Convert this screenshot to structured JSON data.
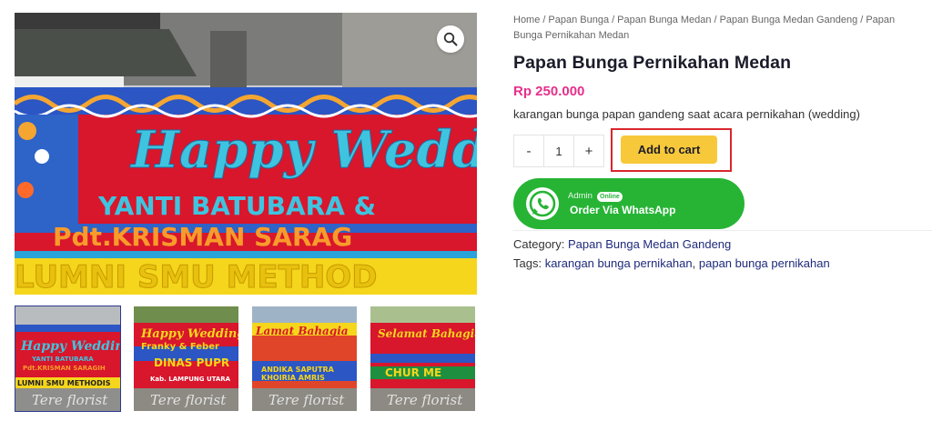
{
  "gallery": {
    "main_image_alt": "Happy Wedding flower board",
    "main_image_text": {
      "line1": "Happy Wedding",
      "line2": "YANTI BATUBARA &",
      "line3": "Pdt.KRISMAN SARAG",
      "line4": "LUMNI SMU METHOD"
    },
    "thumbnails": [
      {
        "l1": "Happy Wedding",
        "l2": "YANTI BATUBARA",
        "l3": "Pdt.KRISMAN SARAGIH",
        "l4": "LUMNI SMU METHODIS",
        "watermark": "Tere florist"
      },
      {
        "l1": "Happy Wedding",
        "l2": "Franky & Feber",
        "l3": "DINAS PUPR",
        "l4": "Kab. LAMPUNG UTARA",
        "watermark": "Tere florist"
      },
      {
        "l1": "Lamat Bahagia",
        "l2": "",
        "l3": "ANDIKA SAPUTRA",
        "l4": "KHOIRIA AMRIS",
        "watermark": "Tere florist"
      },
      {
        "l1": "Selamat Bahagia",
        "l2": "",
        "l3": "",
        "l4": "CHUR ME",
        "watermark": "Tere florist"
      }
    ],
    "zoom_icon": "magnifier-icon"
  },
  "breadcrumb": {
    "items": [
      "Home",
      "Papan Bunga",
      "Papan Bunga Medan",
      "Papan Bunga Medan Gandeng",
      "Papan Bunga Pernikahan Medan"
    ],
    "separator": "/"
  },
  "product": {
    "title": "Papan Bunga Pernikahan Medan",
    "price": "Rp 250.000",
    "description": "karangan bunga papan gandeng saat acara pernikahan (wedding)",
    "quantity": {
      "minus_label": "-",
      "value": "1",
      "plus_label": "+"
    },
    "add_to_cart_label": "Add to cart"
  },
  "whatsapp": {
    "admin_label": "Admin",
    "online_badge": "Online",
    "order_label": "Order Via WhatsApp",
    "icon": "whatsapp-icon",
    "color": "#27b435"
  },
  "meta": {
    "category_label": "Category:",
    "category_value": "Papan Bunga Medan Gandeng",
    "tags_label": "Tags:",
    "tags": [
      "karangan bunga pernikahan",
      "papan bunga pernikahan"
    ],
    "tags_separator": ","
  },
  "colors": {
    "price": "#e5308b",
    "link": "#1e2a7b",
    "cart_button": "#f7c93a",
    "highlight": "#d9262c"
  }
}
